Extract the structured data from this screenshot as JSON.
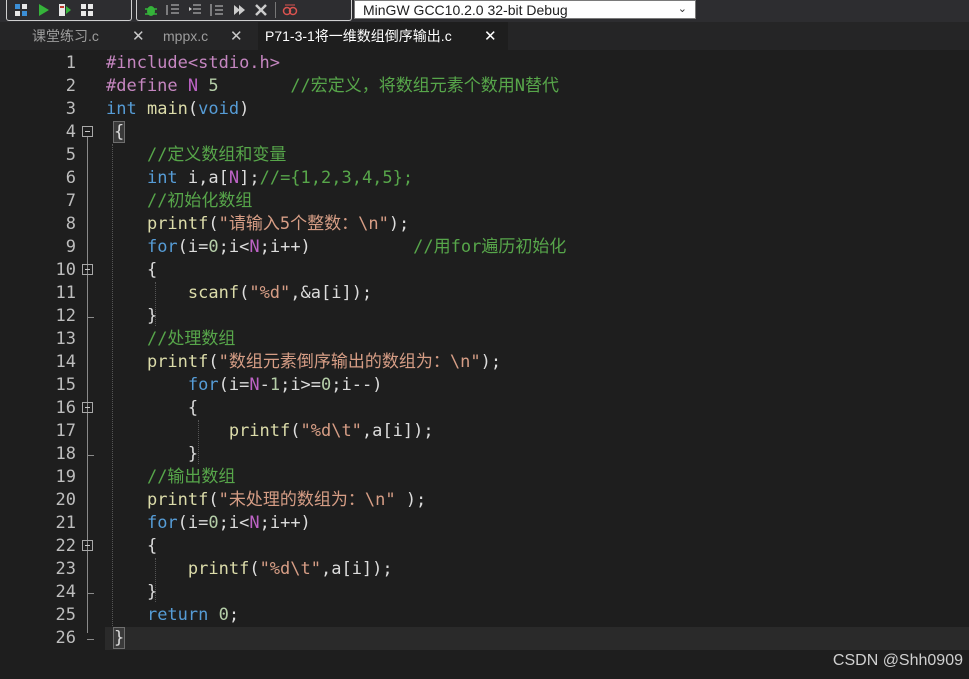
{
  "toolbar": {
    "buttons": [
      "compile-icon",
      "run-icon",
      "compile-run-icon",
      "rebuild-icon",
      "debug-icon",
      "indent-icon",
      "unindent-icon",
      "toggle-comment-icon",
      "step-icon",
      "stop-icon",
      "profile-icon"
    ],
    "compiler": "MinGW GCC10.2.0 32-bit Debug"
  },
  "tabs": [
    {
      "label": "课堂练习.c",
      "active": false
    },
    {
      "label": "mppx.c",
      "active": false
    },
    {
      "label": "P71-3-1将一维数组倒序输出.c",
      "active": true
    }
  ],
  "editor": {
    "lines": [
      {
        "n": "1",
        "text": "#include<stdio.h>"
      },
      {
        "n": "2",
        "text": "#define N 5       //宏定义，将数组元素个数用N替代"
      },
      {
        "n": "3",
        "text": "int main(void)"
      },
      {
        "n": "4",
        "text": "{"
      },
      {
        "n": "5",
        "text": "    //定义数组和变量"
      },
      {
        "n": "6",
        "text": "    int i,a[N];//={1,2,3,4,5};"
      },
      {
        "n": "7",
        "text": "    //初始化数组"
      },
      {
        "n": "8",
        "text": "    printf(\"请输入5个整数：\\n\");"
      },
      {
        "n": "9",
        "text": "    for(i=0;i<N;i++)          //用for遍历初始化"
      },
      {
        "n": "10",
        "text": "    {"
      },
      {
        "n": "11",
        "text": "        scanf(\"%d\",&a[i]);"
      },
      {
        "n": "12",
        "text": "    }"
      },
      {
        "n": "13",
        "text": "    //处理数组"
      },
      {
        "n": "14",
        "text": "    printf(\"数组元素倒序输出的数组为：\\n\");"
      },
      {
        "n": "15",
        "text": "        for(i=N-1;i>=0;i--)"
      },
      {
        "n": "16",
        "text": "        {"
      },
      {
        "n": "17",
        "text": "            printf(\"%d\\t\",a[i]);"
      },
      {
        "n": "18",
        "text": "        }"
      },
      {
        "n": "19",
        "text": "    //输出数组"
      },
      {
        "n": "20",
        "text": "    printf(\"未处理的数组为：\\n\" );"
      },
      {
        "n": "21",
        "text": "    for(i=0;i<N;i++)"
      },
      {
        "n": "22",
        "text": "    {"
      },
      {
        "n": "23",
        "text": "        printf(\"%d\\t\",a[i]);"
      },
      {
        "n": "24",
        "text": "    }"
      },
      {
        "n": "25",
        "text": "    return 0;"
      },
      {
        "n": "26",
        "text": "}"
      }
    ]
  },
  "watermark": "CSDN @Shh0909",
  "colors": {
    "background": "#1e1e1e",
    "keyword": "#569cd6",
    "function": "#dcdcaa",
    "string": "#d69d85",
    "comment": "#57a64a",
    "preprocessor": "#c586c0"
  }
}
